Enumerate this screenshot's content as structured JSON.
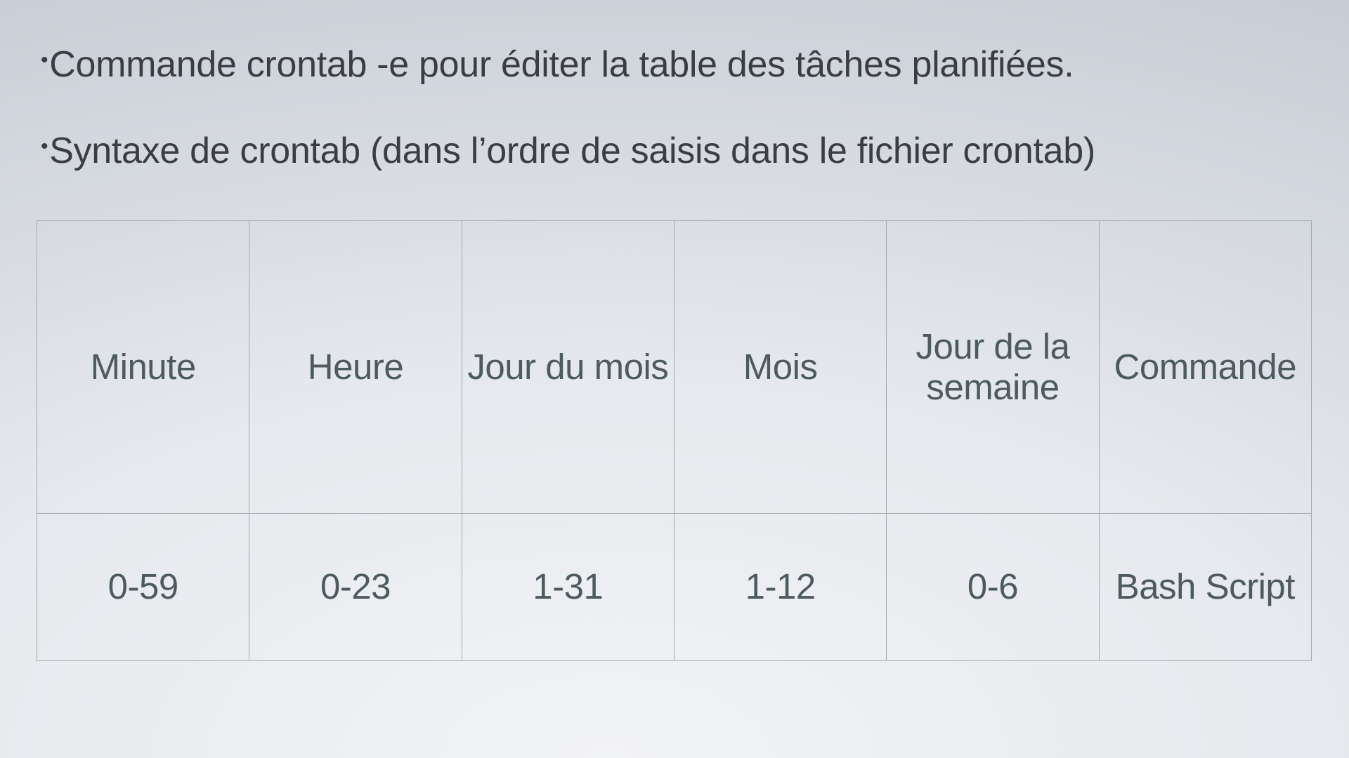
{
  "slide": {
    "bullets": [
      "Commande crontab -e pour éditer la table des tâches planifiées.",
      "Syntaxe de crontab (dans l’ordre de saisis dans le fichier crontab)"
    ],
    "bullet_glyph": "•",
    "table": {
      "headers": [
        "Minute",
        "Heure",
        "Jour du mois",
        "Mois",
        "Jour de la semaine",
        "Commande"
      ],
      "values": [
        "0-59",
        "0-23",
        "1-31",
        "1-12",
        "0-6",
        "Bash Script"
      ]
    },
    "colors": {
      "bullet_text": "#3a3d41",
      "table_text": "#4d5b60",
      "table_border": "#a4a8ac"
    }
  }
}
